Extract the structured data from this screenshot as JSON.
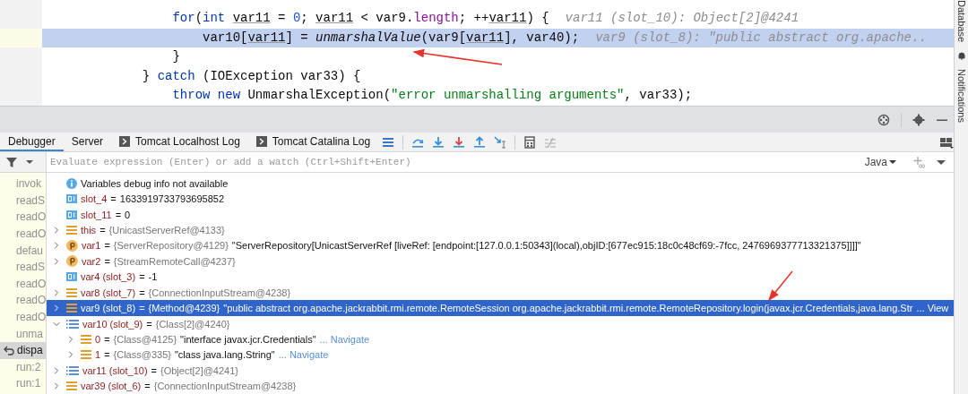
{
  "editor": {
    "lines": [
      {
        "highlighted": false,
        "hint": "var11 (slot_10): Object[2]@4241",
        "tokens": [
          {
            "text": "                for",
            "kind": "keyword"
          },
          {
            "text": "(",
            "kind": "plain"
          },
          {
            "text": "int ",
            "kind": "keyword"
          },
          {
            "text": "var11",
            "kind": "local"
          },
          {
            "text": " = ",
            "kind": "plain"
          },
          {
            "text": "0",
            "kind": "number"
          },
          {
            "text": "; ",
            "kind": "plain"
          },
          {
            "text": "var11",
            "kind": "local"
          },
          {
            "text": " < var9.",
            "kind": "plain"
          },
          {
            "text": "length",
            "kind": "field"
          },
          {
            "text": "; ++",
            "kind": "plain"
          },
          {
            "text": "var11",
            "kind": "local"
          },
          {
            "text": ") {",
            "kind": "plain"
          }
        ]
      },
      {
        "highlighted": true,
        "hint": "var9 (slot_8): \"public abstract org.apache..",
        "tokens": [
          {
            "text": "                    var10[",
            "kind": "plain"
          },
          {
            "text": "var11",
            "kind": "local"
          },
          {
            "text": "] = ",
            "kind": "plain"
          },
          {
            "text": "unmarshalValue",
            "kind": "method"
          },
          {
            "text": "(var9[",
            "kind": "plain"
          },
          {
            "text": "var11",
            "kind": "local"
          },
          {
            "text": "], var40);",
            "kind": "plain"
          }
        ]
      },
      {
        "highlighted": false,
        "tokens": [
          {
            "text": "                }",
            "kind": "plain"
          }
        ]
      },
      {
        "highlighted": false,
        "tokens": [
          {
            "text": "            } ",
            "kind": "plain"
          },
          {
            "text": "catch",
            "kind": "keyword"
          },
          {
            "text": " (IOException var33) {",
            "kind": "plain"
          }
        ]
      },
      {
        "highlighted": false,
        "tokens": [
          {
            "text": "                throw new",
            "kind": "keyword"
          },
          {
            "text": " UnmarshalException(",
            "kind": "plain"
          },
          {
            "text": "\"error unmarshalling arguments\"",
            "kind": "string"
          },
          {
            "text": ", var33);",
            "kind": "plain"
          }
        ]
      }
    ]
  },
  "side_tools": [
    "Database",
    "Notifications"
  ],
  "tabs": [
    {
      "label": "Debugger",
      "selected": true,
      "kind": "plain"
    },
    {
      "label": "Server",
      "selected": false,
      "kind": "plain"
    },
    {
      "label": "Tomcat Localhost Log",
      "selected": false,
      "kind": "console"
    },
    {
      "label": "Tomcat Catalina Log",
      "selected": false,
      "kind": "console"
    }
  ],
  "watch": {
    "placeholder": "Evaluate expression (Enter) or add a watch (Ctrl+Shift+Enter)",
    "language": "Java"
  },
  "frames": [
    {
      "label": "invok",
      "selected": false
    },
    {
      "label": "readS",
      "selected": false
    },
    {
      "label": "readO",
      "selected": false
    },
    {
      "label": "readO",
      "selected": false
    },
    {
      "label": "defau",
      "selected": false
    },
    {
      "label": "readS",
      "selected": false
    },
    {
      "label": "readO",
      "selected": false
    },
    {
      "label": "readO",
      "selected": false
    },
    {
      "label": "readO",
      "selected": false
    },
    {
      "label": "unma",
      "selected": false
    },
    {
      "label": "dispa",
      "selected": true
    },
    {
      "label": "run:2",
      "selected": false
    },
    {
      "label": "run:1",
      "selected": false
    }
  ],
  "variables": [
    {
      "kind": "info",
      "name": "Variables debug info not available",
      "selected": false
    },
    {
      "kind": "primitive",
      "name": "slot_4",
      "operator": "=",
      "value": "1633919733793695852",
      "selected": false
    },
    {
      "kind": "primitive",
      "name": "slot_11",
      "operator": "=",
      "value": "0",
      "selected": false
    },
    {
      "kind": "object",
      "name": "this",
      "operator": "=",
      "type": "{UnicastServerRef@4133}",
      "expanded": false,
      "selected": false
    },
    {
      "kind": "param",
      "name": "var1",
      "operator": "=",
      "type": "{ServerRepository@4129}",
      "value": "\"ServerRepository[UnicastServerRef [liveRef: [endpoint:[127.0.0.1:50343](local),objID:[677ec915:18c0c48cf69:-7fcc, 2476969377713321375]]]]\"",
      "expanded": false,
      "selected": false
    },
    {
      "kind": "param",
      "name": "var2",
      "operator": "=",
      "type": "{StreamRemoteCall@4237}",
      "expanded": false,
      "selected": false
    },
    {
      "kind": "primitive",
      "name": "var4 (slot_3)",
      "operator": "=",
      "value": "-1",
      "selected": false
    },
    {
      "kind": "object",
      "name": "var8 (slot_7)",
      "operator": "=",
      "type": "{ConnectionInputStream@4238}",
      "expanded": false,
      "selected": false
    },
    {
      "kind": "object",
      "name": "var9 (slot_8)",
      "operator": "=",
      "type": "{Method@4239}",
      "value": "\"public abstract org.apache.jackrabbit.rmi.remote.RemoteSession org.apache.jackrabbit.rmi.remote.RemoteRepository.login(javax.jcr.Credentials,java.lang.Str",
      "link": "... View",
      "expanded": false,
      "selected": true
    },
    {
      "kind": "array",
      "name": "var10 (slot_9)",
      "operator": "=",
      "type": "{Class[2]@4240}",
      "expanded": true,
      "selected": false,
      "children": [
        {
          "kind": "object",
          "name": "0",
          "operator": "=",
          "type": "{Class@4125}",
          "value": "\"interface javax.jcr.Credentials\"",
          "link": "... Navigate",
          "expanded": false,
          "selected": false
        },
        {
          "kind": "object",
          "name": "1",
          "operator": "=",
          "type": "{Class@335}",
          "value": "\"class java.lang.String\"",
          "link": "... Navigate",
          "expanded": false,
          "selected": false
        }
      ]
    },
    {
      "kind": "array",
      "name": "var11 (slot_10)",
      "operator": "=",
      "type": "{Object[2]@4241}",
      "expanded": false,
      "selected": false
    },
    {
      "kind": "object",
      "name": "var39 (slot_6)",
      "operator": "=",
      "type": "{ConnectionInputStream@4238}",
      "expanded": false,
      "selected": false
    }
  ]
}
